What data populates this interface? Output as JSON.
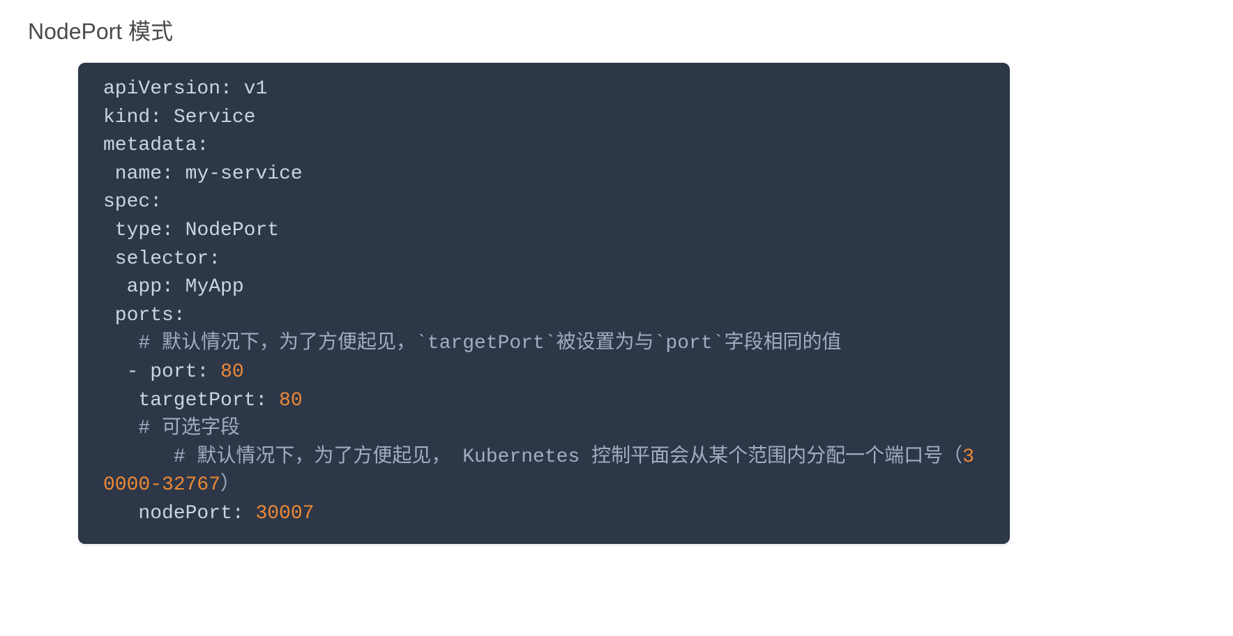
{
  "heading": "NodePort 模式",
  "code": {
    "apiVersion_key": "apiVersion",
    "apiVersion_value": "v1",
    "kind_key": "kind",
    "kind_value": "Service",
    "metadata_key": "metadata",
    "name_key": "name",
    "name_value": "my-service",
    "spec_key": "spec",
    "type_key": "type",
    "type_value": "NodePort",
    "selector_key": "selector",
    "app_key": "app",
    "app_value": "MyApp",
    "ports_key": "ports",
    "comment1": "# 默认情况下，为了方便起见，`targetPort`被设置为与`port`字段相同的值",
    "dash": "-",
    "port_key": "port",
    "port_value": "80",
    "targetPort_key": "targetPort",
    "targetPort_value": "80",
    "comment2": "# 可选字段",
    "comment3_part1": "# 默认情况下，为了方便起见， Kubernetes 控制平面会从某个范围内分配一个端口号（",
    "comment3_range": "30000-32767",
    "comment3_part2": "）",
    "nodePort_key": "nodePort",
    "nodePort_value": "30007",
    "colon": ":",
    "space": " "
  }
}
